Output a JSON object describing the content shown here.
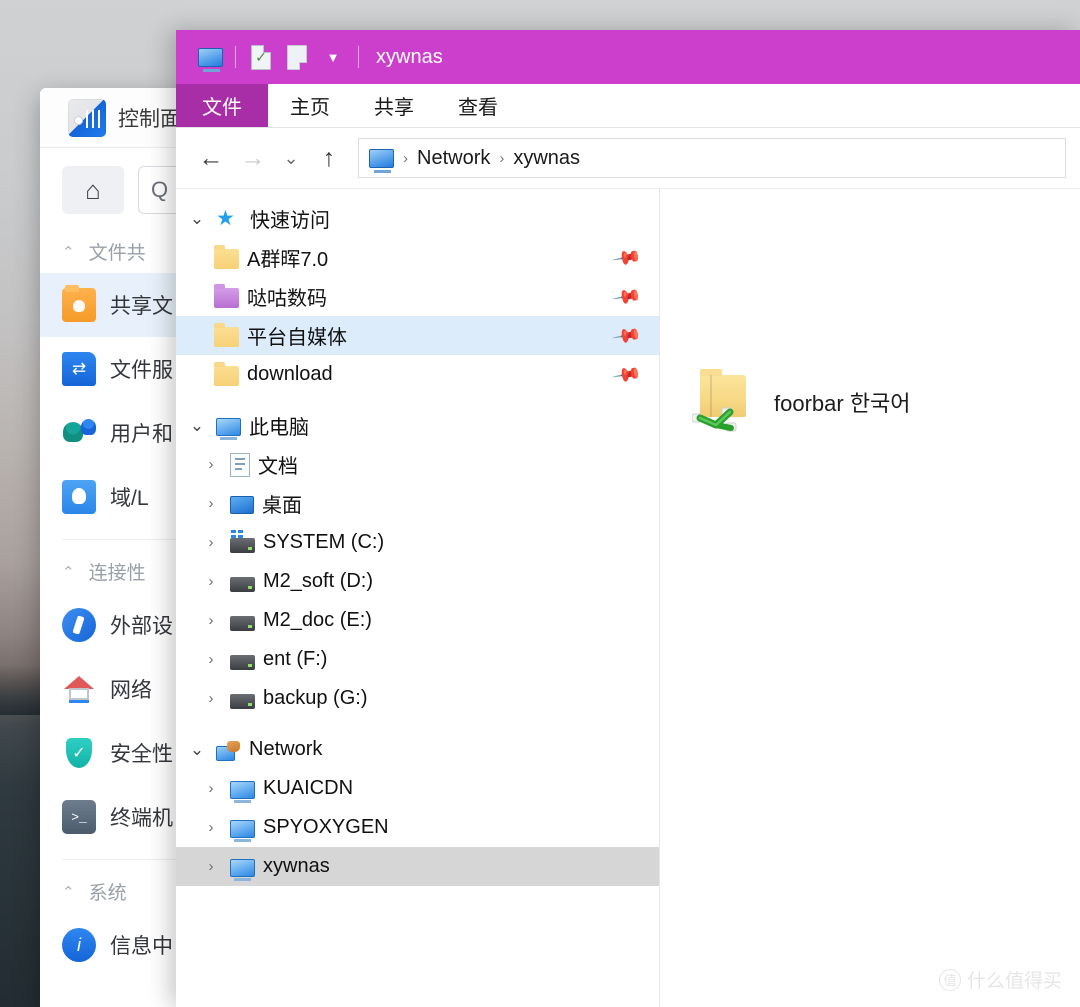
{
  "desktop": {
    "name": "desktop-wallpaper"
  },
  "background_window": {
    "title": "控制面板",
    "icon": "control-panel-icon",
    "search_placeholder": "Q",
    "home_icon": "home-icon",
    "groups": [
      {
        "label": "文件共",
        "collapse_icon": "chevron-up-icon",
        "items": [
          {
            "label": "共享文",
            "icon": "shared-folder-user-icon",
            "active": true
          },
          {
            "label": "文件服",
            "icon": "file-sync-icon",
            "active": false
          },
          {
            "label": "用户和",
            "icon": "users-icon",
            "active": false
          },
          {
            "label": "域/L",
            "icon": "domain-icon",
            "active": false
          }
        ]
      },
      {
        "label": "连接性",
        "collapse_icon": "chevron-up-icon",
        "items": [
          {
            "label": "外部设",
            "icon": "external-device-icon",
            "active": false
          },
          {
            "label": "网络",
            "icon": "network-home-icon",
            "active": false
          },
          {
            "label": "安全性",
            "icon": "shield-check-icon",
            "active": false
          },
          {
            "label": "终端机",
            "icon": "terminal-icon",
            "active": false
          }
        ]
      },
      {
        "label": "系统",
        "collapse_icon": "chevron-up-icon",
        "items": [
          {
            "label": "信息中",
            "icon": "info-icon",
            "active": false
          }
        ]
      }
    ]
  },
  "explorer": {
    "titlebar": {
      "title": "xywnas",
      "accent_color": "#cc3fcc",
      "quick_access": [
        {
          "name": "this-pc-icon"
        },
        {
          "name": "properties-icon"
        },
        {
          "name": "new-folder-icon"
        },
        {
          "name": "customize-caret-icon"
        }
      ]
    },
    "ribbon": {
      "active_tab": "文件",
      "active_tab_color": "#a82ea8",
      "tabs": [
        "主页",
        "共享",
        "查看"
      ]
    },
    "address_bar": {
      "back_icon": "back-arrow-icon",
      "forward_icon": "forward-arrow-icon",
      "recent_icon": "recent-locations-caret-icon",
      "up_icon": "up-arrow-icon",
      "crumb_icon": "this-pc-icon",
      "breadcrumbs": [
        "Network",
        "xywnas"
      ],
      "separator": "›"
    },
    "nav_pane": {
      "sections": [
        {
          "label": "快速访问",
          "icon": "quick-access-star-icon",
          "twisty": "⌄",
          "children": [
            {
              "label": "A群晖7.0",
              "icon": "folder-yellow-icon",
              "pinned": true,
              "selected": false
            },
            {
              "label": "哒咕数码",
              "icon": "folder-purple-icon",
              "pinned": true,
              "selected": false
            },
            {
              "label": "平台自媒体",
              "icon": "folder-yellow-icon",
              "pinned": true,
              "selected": true
            },
            {
              "label": "download",
              "icon": "folder-yellow-icon",
              "pinned": true,
              "selected": false
            }
          ]
        },
        {
          "label": "此电脑",
          "icon": "this-pc-icon",
          "twisty": "⌄",
          "children": [
            {
              "label": "文档",
              "icon": "documents-icon",
              "twisty": "›",
              "pinned": false,
              "selected": false
            },
            {
              "label": "桌面",
              "icon": "desktop-icon",
              "twisty": "›",
              "pinned": false,
              "selected": false
            },
            {
              "label": "SYSTEM (C:)",
              "icon": "system-drive-icon",
              "twisty": "›",
              "pinned": false,
              "selected": false
            },
            {
              "label": "M2_soft (D:)",
              "icon": "drive-icon",
              "twisty": "›",
              "pinned": false,
              "selected": false
            },
            {
              "label": "M2_doc (E:)",
              "icon": "drive-icon",
              "twisty": "›",
              "pinned": false,
              "selected": false
            },
            {
              "label": "ent (F:)",
              "icon": "drive-icon",
              "twisty": "›",
              "pinned": false,
              "selected": false
            },
            {
              "label": "backup (G:)",
              "icon": "drive-icon",
              "twisty": "›",
              "pinned": false,
              "selected": false
            }
          ]
        },
        {
          "label": "Network",
          "icon": "network-icon",
          "twisty": "⌄",
          "children": [
            {
              "label": "KUAICDN",
              "icon": "computer-icon",
              "twisty": "›",
              "pinned": false,
              "selected": false
            },
            {
              "label": "SPYOXYGEN",
              "icon": "computer-icon",
              "twisty": "›",
              "pinned": false,
              "selected": false
            },
            {
              "label": "xywnas",
              "icon": "computer-icon",
              "twisty": "›",
              "pinned": false,
              "selected": true
            }
          ]
        }
      ]
    },
    "content": {
      "items": [
        {
          "label": "foorbar 한국어",
          "icon": "shared-folder-icon"
        }
      ]
    },
    "annotation": {
      "name": "red-circle-highlight",
      "color": "#c0272d"
    }
  },
  "watermark": {
    "badge": "值",
    "text": "什么值得买"
  }
}
